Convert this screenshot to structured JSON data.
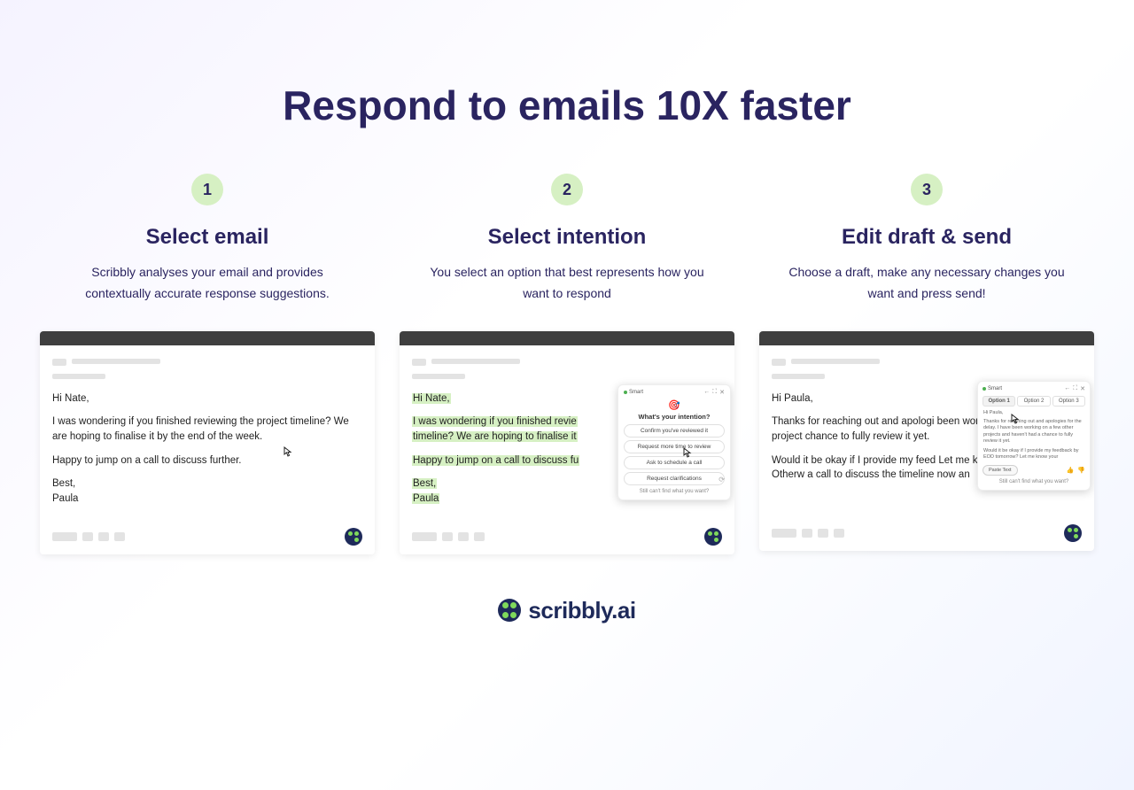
{
  "headline": "Respond to emails 10X faster",
  "steps": [
    {
      "num": "1",
      "title": "Select email",
      "desc": "Scribbly analyses your email and provides contextually accurate response suggestions."
    },
    {
      "num": "2",
      "title": "Select intention",
      "desc": "You select an option that best represents how you want to respond"
    },
    {
      "num": "3",
      "title": "Edit draft & send",
      "desc": "Choose a draft, make any necessary changes you want and press send!"
    }
  ],
  "email1": {
    "greeting": "Hi Nate,",
    "p1": "I was wondering if you finished reviewing the project timeline? We are hoping to finalise it by the end of the week.",
    "p2": "Happy to jump on a call to discuss further.",
    "signoff": "Best,",
    "sender": "Paula"
  },
  "email2": {
    "greeting": "Hi Nate,",
    "p1a": "I was wondering if you finished revie",
    "p1b": "timeline? We are hoping to finalise it",
    "p2": "Happy to jump on a call to discuss fu",
    "signoff": "Best,",
    "sender": "Paula"
  },
  "popup_intent": {
    "smart": "Smart",
    "title": "What's your intention?",
    "options": [
      "Confirm you've reviewed it",
      "Request more time to review",
      "Ask to schedule a call",
      "Request clarifications"
    ],
    "footer": "Still can't find what you want?"
  },
  "email3": {
    "greeting": "Hi Paula,",
    "p1": "Thanks for reaching out and apologi been working on a few other project chance to fully review it yet.",
    "p2": "Would it be okay if I provide my feed Let me know your thoughts. Otherw a call to discuss the timeline now an"
  },
  "popup_draft": {
    "smart": "Smart",
    "tabs": [
      "Option 1",
      "Option 2",
      "Option 3"
    ],
    "greeting": "Hi Paula,",
    "p1": "Thanks for reaching out and apologies for the delay. I have been working on a few other projects and haven't had a chance to fully review it yet.",
    "p2": "Would it be okay if I provide my feedback by EOD tomorrow? Let me know your",
    "paste": "Paste Text",
    "footer": "Still can't find what you want?"
  },
  "brand": "scribbly.ai"
}
